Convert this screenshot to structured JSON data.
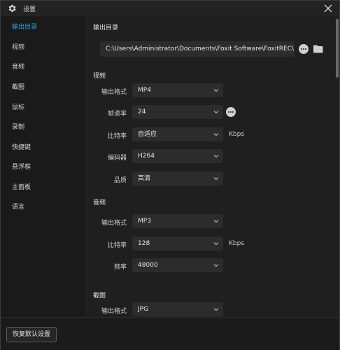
{
  "window": {
    "title": "设置"
  },
  "sidebar": {
    "items": [
      {
        "label": "输出目录",
        "active": true
      },
      {
        "label": "视频"
      },
      {
        "label": "音频"
      },
      {
        "label": "截图"
      },
      {
        "label": "鼠标"
      },
      {
        "label": "录制"
      },
      {
        "label": "快捷键"
      },
      {
        "label": "悬浮框"
      },
      {
        "label": "主面板"
      },
      {
        "label": "语言"
      }
    ]
  },
  "output": {
    "title": "输出目录",
    "path": "C:\\Users\\Administrator\\Documents\\Foxit Software\\FoxitREC\\"
  },
  "video": {
    "title": "视频",
    "format_label": "输出格式",
    "format_value": "MP4",
    "fps_label": "帧速率",
    "fps_value": "24",
    "bitrate_label": "比特率",
    "bitrate_value": "自适应",
    "bitrate_unit": "Kbps",
    "encoder_label": "编码器",
    "encoder_value": "H264",
    "quality_label": "品质",
    "quality_value": "高清"
  },
  "audio": {
    "title": "音频",
    "format_label": "输出格式",
    "format_value": "MP3",
    "bitrate_label": "比特率",
    "bitrate_value": "128",
    "bitrate_unit": "Kbps",
    "freq_label": "频率",
    "freq_value": "48000"
  },
  "screenshot": {
    "title": "截图",
    "format_label": "输出格式",
    "format_value": "JPG"
  },
  "footer": {
    "restore_label": "恢复默认设置"
  },
  "colors": {
    "accent": "#2aa3e0",
    "background": "#1f1f1f",
    "field": "#2c2c2c"
  }
}
